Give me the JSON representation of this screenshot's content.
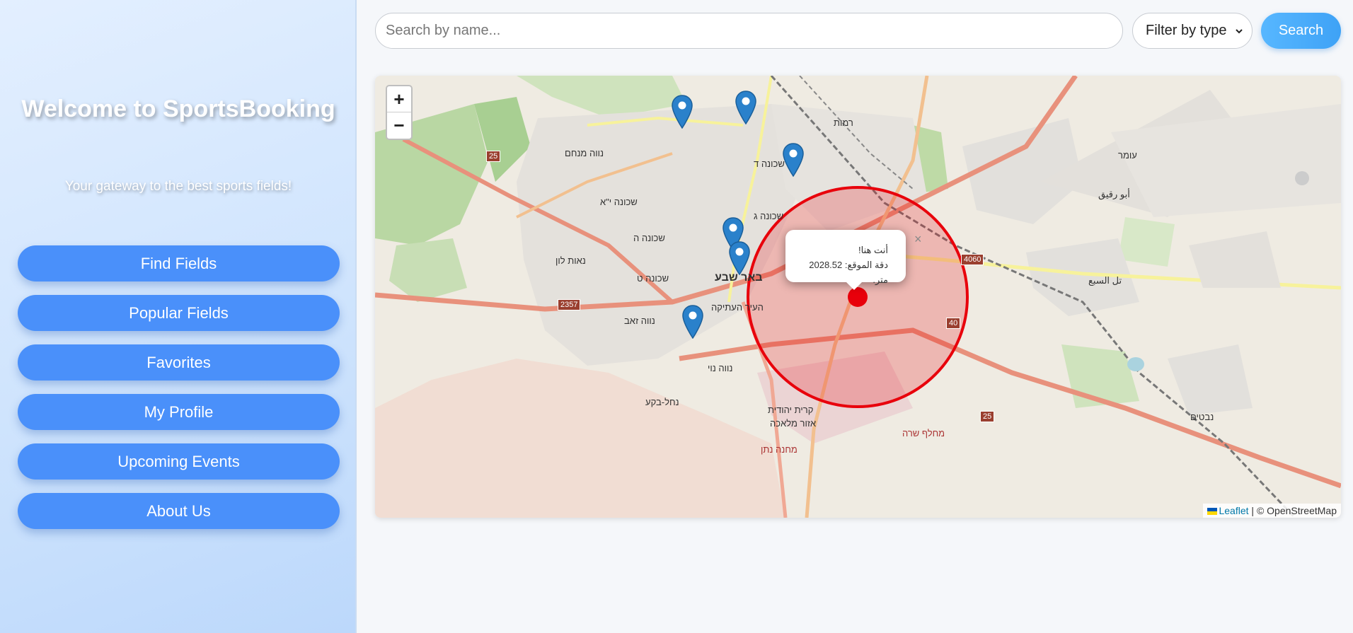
{
  "sidebar": {
    "title": "Welcome to SportsBooking",
    "tagline": "Your gateway to the best sports fields!",
    "nav": [
      {
        "label": "Find Fields"
      },
      {
        "label": "Popular Fields"
      },
      {
        "label": "Favorites"
      },
      {
        "label": "My Profile"
      },
      {
        "label": "Upcoming Events"
      },
      {
        "label": "About Us"
      }
    ]
  },
  "search": {
    "placeholder": "Search by name...",
    "value": "",
    "filter_selected": "Filter by type",
    "button_label": "Search"
  },
  "map": {
    "zoom_in": "+",
    "zoom_out": "−",
    "popup": {
      "line1": "أنت هنا!",
      "line2": "دقة الموقع: 2028.52 متر."
    },
    "popup_close": "×",
    "attribution_leaflet": "Leaflet",
    "attribution_rest": " | © OpenStreetMap",
    "labels": [
      {
        "text": "שכונה ד"
      },
      {
        "text": "שכונה ג"
      },
      {
        "text": "נווה מנחם"
      },
      {
        "text": "שכונה י\"א"
      },
      {
        "text": "שכונה ה"
      },
      {
        "text": "נאות לון"
      },
      {
        "text": "שכונה ט"
      },
      {
        "text": "באר שבע"
      },
      {
        "text": "העיר העתיקה"
      },
      {
        "text": "נווה זאב"
      },
      {
        "text": "נווה נוי"
      },
      {
        "text": "נחל-בקע"
      },
      {
        "text": "קרית יהודית"
      },
      {
        "text": "אזור מלאכה"
      },
      {
        "text": "רמות"
      },
      {
        "text": "עומר"
      },
      {
        "text": "تل السبع"
      },
      {
        "text": "أبو رقيق"
      },
      {
        "text": "נבטים"
      },
      {
        "text": "מחנה נתן"
      },
      {
        "text": "מחלף שרה"
      }
    ],
    "road_numbers": [
      "25",
      "2357",
      "4060",
      "40",
      "25"
    ],
    "colors": {
      "marker": "#2a81cb",
      "accuracy_circle": "#e8000b",
      "nav_button": "#4a90fa"
    }
  }
}
